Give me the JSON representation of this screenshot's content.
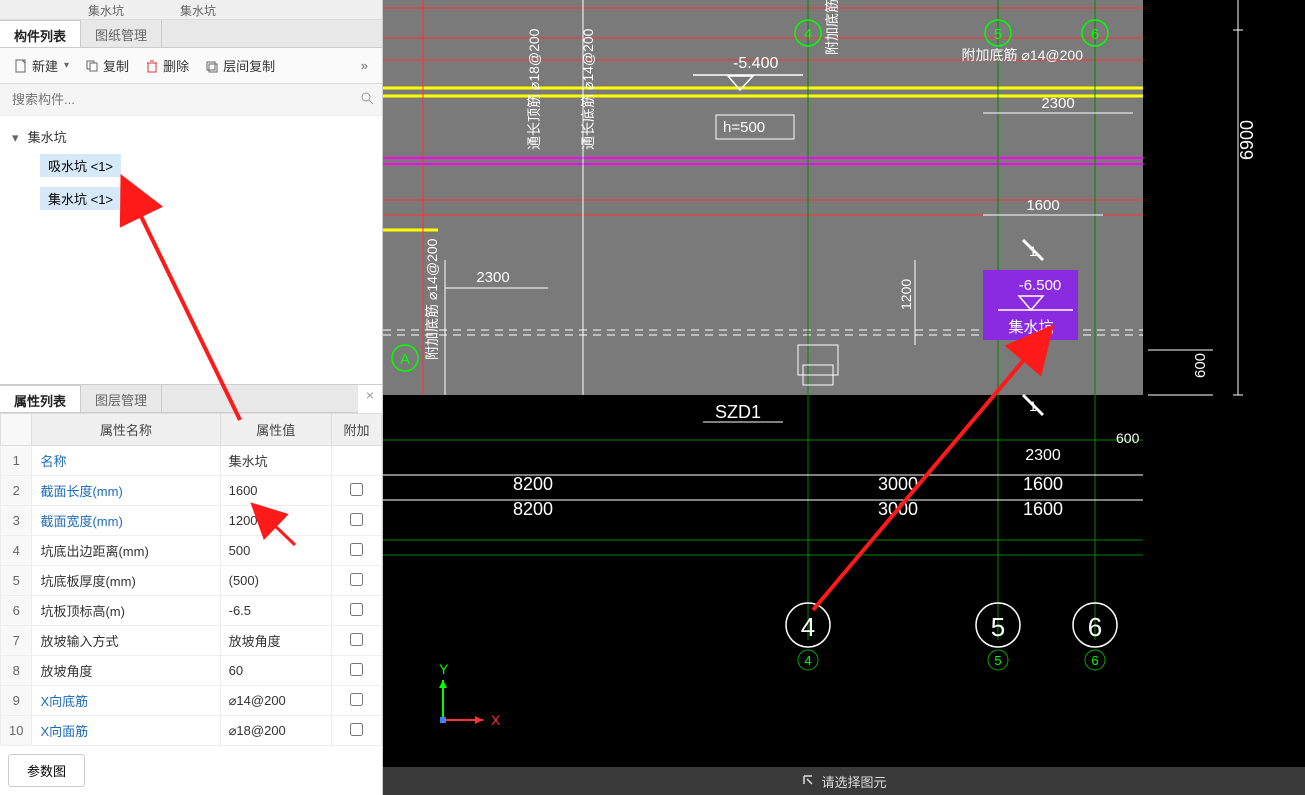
{
  "top_stubs": [
    "集水坑",
    "集水坑"
  ],
  "left": {
    "tabs": {
      "component_list": "构件列表",
      "drawing_mgmt": "图纸管理"
    },
    "toolbar": {
      "new": "新建",
      "copy": "复制",
      "delete": "删除",
      "layer_copy": "层间复制",
      "more": "»"
    },
    "search_placeholder": "搜索构件...",
    "tree": {
      "root": "集水坑",
      "children": [
        {
          "label": "吸水坑 <1>",
          "selected": false
        },
        {
          "label": "集水坑 <1>",
          "selected": true
        }
      ]
    }
  },
  "props": {
    "tabs": {
      "prop_list": "属性列表",
      "layer_mgmt": "图层管理"
    },
    "headers": {
      "name": "属性名称",
      "value": "属性值",
      "extra": "附加"
    },
    "rows": [
      {
        "n": "1",
        "name": "名称",
        "value": "集水坑",
        "link": true,
        "check": null
      },
      {
        "n": "2",
        "name": "截面长度(mm)",
        "value": "1600",
        "link": true,
        "check": false
      },
      {
        "n": "3",
        "name": "截面宽度(mm)",
        "value": "1200",
        "link": true,
        "check": false
      },
      {
        "n": "4",
        "name": "坑底出边距离(mm)",
        "value": "500",
        "link": false,
        "check": false
      },
      {
        "n": "5",
        "name": "坑底板厚度(mm)",
        "value": "(500)",
        "link": false,
        "check": false
      },
      {
        "n": "6",
        "name": "坑板顶标高(m)",
        "value": "-6.5",
        "link": false,
        "check": false
      },
      {
        "n": "7",
        "name": "放坡输入方式",
        "value": "放坡角度",
        "link": false,
        "check": false
      },
      {
        "n": "8",
        "name": "放坡角度",
        "value": "60",
        "link": false,
        "check": false
      },
      {
        "n": "9",
        "name": "X向底筋",
        "value": "⌀14@200",
        "link": true,
        "check": false
      },
      {
        "n": "10",
        "name": "X向面筋",
        "value": "⌀18@200",
        "link": true,
        "check": false
      }
    ],
    "param_btn": "参数图"
  },
  "canvas": {
    "labels": {
      "elev1": "-5.400",
      "h500": "h=500",
      "elev2": "-6.500",
      "sump": "集水坑",
      "szd": "SZD1",
      "rebar1": "通长顶筋 ⌀18@200",
      "rebar2": "通长底筋 ⌀14@200",
      "rebar3": "附加底筋 ⌀14@200",
      "rebar4": "附加底筋",
      "rebar5": "附加底筋 ⌀14@200"
    },
    "dims": {
      "d2300a": "2300",
      "d2300b": "2300",
      "d2300c": "2300",
      "d1600a": "1600",
      "d1600b": "1600",
      "d1600c": "1600",
      "d1200": "1200",
      "d6900": "6900",
      "d600a": "600",
      "d600b": "600",
      "d8200a": "8200",
      "d8200b": "8200",
      "d3000a": "3000",
      "d3000b": "3000"
    },
    "grid_bubbles": {
      "A": "A",
      "g4t": "4",
      "g5t": "5",
      "g6t": "6",
      "g4b": "4",
      "g5b": "5",
      "g6b": "6",
      "g4bs": "4",
      "g5bs": "5",
      "g6bs": "6"
    },
    "axis": {
      "x": "X",
      "y": "Y"
    }
  },
  "status_bar": "请选择图元"
}
